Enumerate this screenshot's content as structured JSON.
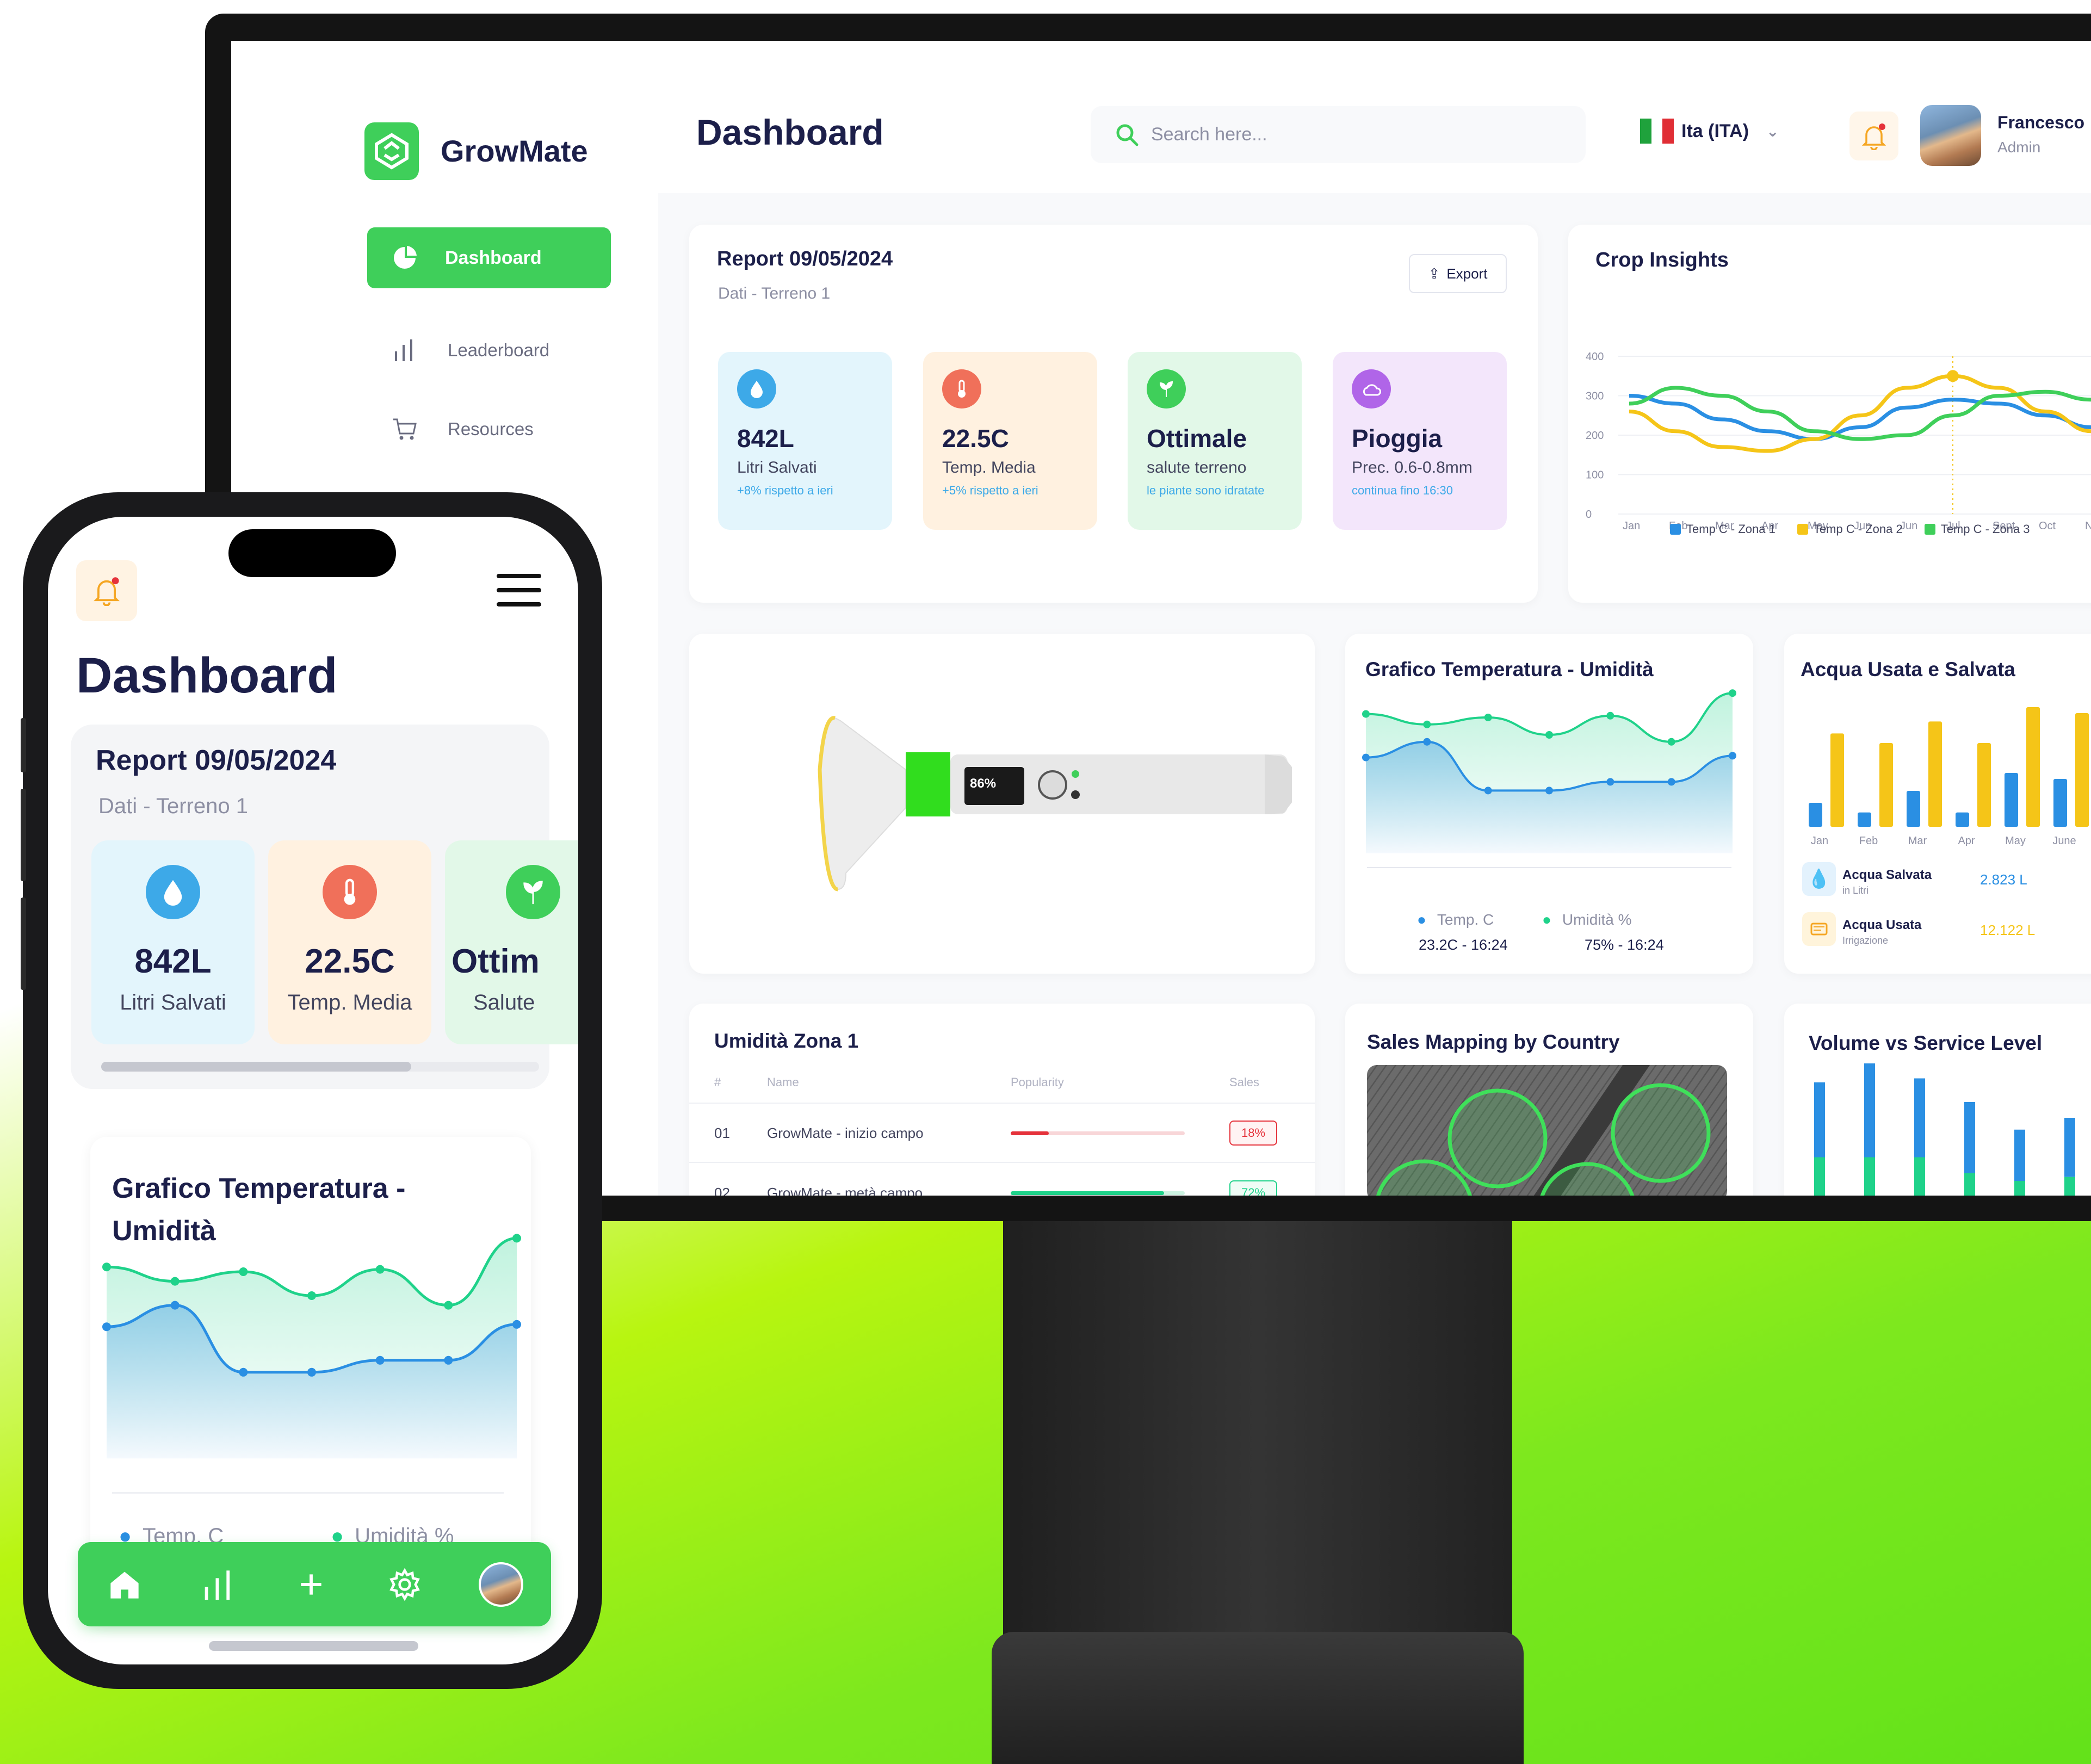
{
  "app": {
    "brand": "GrowMate",
    "page_title": "Dashboard"
  },
  "sidebar": {
    "items": [
      {
        "label": "Dashboard",
        "icon": "pie-chart-icon",
        "active": true
      },
      {
        "label": "Leaderboard",
        "icon": "bar-chart-icon"
      },
      {
        "label": "Resources",
        "icon": "cart-icon"
      }
    ]
  },
  "header": {
    "search_placeholder": "Search here...",
    "language": "Ita (ITA)",
    "user": {
      "name": "Francesco",
      "role": "Admin"
    }
  },
  "report": {
    "title": "Report 09/05/2024",
    "subtitle": "Dati - Terreno 1",
    "export_label": "Export",
    "kpis": [
      {
        "value": "842L",
        "label": "Litri Salvati",
        "note": "+8% rispetto a ieri",
        "icon": "water-drop-icon",
        "bg": "#e3f5fc",
        "accent": "#3da9e8"
      },
      {
        "value": "22.5C",
        "label": "Temp. Media",
        "note": "+5% rispetto a ieri",
        "icon": "thermometer-icon",
        "bg": "#fff1e0",
        "accent": "#f0705a"
      },
      {
        "value": "Ottimale",
        "label": "salute terreno",
        "note": "le piante sono idratate",
        "icon": "plant-icon",
        "bg": "#e2f8e8",
        "accent": "#3fcf5a"
      },
      {
        "value": "Pioggia",
        "label": "Prec. 0.6-0.8mm",
        "note": "continua fino 16:30",
        "icon": "cloud-sun-icon",
        "bg": "#f3e6fb",
        "accent": "#b065e8"
      }
    ]
  },
  "crop_insights": {
    "title": "Crop Insights"
  },
  "temp_hum": {
    "title": "Grafico Temperatura - Umidità",
    "legend": [
      {
        "label": "Temp. C",
        "value": "23.2C - 16:24",
        "color": "#2a8fe3"
      },
      {
        "label": "Umidità %",
        "value": "75% - 16:24",
        "color": "#1fd28a"
      }
    ]
  },
  "water": {
    "title": "Acqua Usata e Salvata",
    "saved": {
      "label": "Acqua Salvata",
      "sub": "in Litri",
      "value": "2.823 L"
    },
    "used": {
      "label": "Acqua Usata",
      "sub": "Irrigazione",
      "value": "12.122 L"
    }
  },
  "humidity_table": {
    "title": "Umidità Zona 1",
    "columns": [
      "#",
      "Name",
      "Popularity",
      "Sales"
    ],
    "rows": [
      {
        "num": "01",
        "name": "GrowMate - inizio campo",
        "popularity": 0.22,
        "sales": "18%",
        "color": "#e5323b"
      },
      {
        "num": "02",
        "name": "GrowMate - metà campo",
        "popularity": 0.88,
        "sales": "72%",
        "color": "#1fd28a"
      }
    ]
  },
  "sales_map": {
    "title": "Sales Mapping by Country"
  },
  "volume": {
    "title": "Volume vs Service Level"
  },
  "device": {
    "display_value": "86%"
  },
  "phone": {
    "title": "Dashboard",
    "report_title": "Report 09/05/2024",
    "report_subtitle": "Dati - Terreno 1",
    "kpis": [
      {
        "value": "842L",
        "label": "Litri Salvati"
      },
      {
        "value": "22.5C",
        "label": "Temp. Media"
      },
      {
        "value": "Ottim",
        "label": "Salute"
      }
    ],
    "chart_title_1": "Grafico Temperatura -",
    "chart_title_2": "Umidità",
    "legend_temp": "Temp. C",
    "legend_hum": "Umidità %"
  },
  "chart_data": [
    {
      "type": "line",
      "title": "Crop Insights",
      "categories": [
        "Jan",
        "Feb",
        "Mar",
        "Apr",
        "May",
        "Jun",
        "Jun",
        "Jul",
        "Sept",
        "Oct",
        "Nov"
      ],
      "ylim": [
        0,
        400
      ],
      "yticks": [
        0,
        100,
        200,
        300,
        400
      ],
      "series": [
        {
          "name": "Temp C - Zona 1",
          "color": "#2a8fe3",
          "values": [
            300,
            280,
            240,
            210,
            190,
            220,
            270,
            290,
            280,
            250,
            220
          ]
        },
        {
          "name": "Temp C - Zona 2",
          "color": "#f5c518",
          "values": [
            260,
            210,
            170,
            160,
            190,
            250,
            320,
            350,
            320,
            260,
            210
          ]
        },
        {
          "name": "Temp C - Zona 3",
          "color": "#3fcf5a",
          "values": [
            280,
            320,
            300,
            260,
            210,
            190,
            200,
            250,
            300,
            310,
            290
          ]
        }
      ],
      "legend": "bottom"
    },
    {
      "type": "area",
      "title": "Grafico Temperatura - Umidità",
      "x": [
        1,
        2,
        3,
        4,
        5,
        6,
        7
      ],
      "series": [
        {
          "name": "Umidità %",
          "color": "#1fd28a",
          "values": [
            82,
            76,
            80,
            70,
            81,
            66,
            94
          ]
        },
        {
          "name": "Temp. C",
          "color": "#2a8fe3",
          "values": [
            57,
            66,
            38,
            38,
            43,
            43,
            58
          ]
        }
      ]
    },
    {
      "type": "bar",
      "title": "Acqua Usata e Salvata",
      "categories": [
        "Jan",
        "Feb",
        "Mar",
        "Apr",
        "May",
        "June"
      ],
      "series": [
        {
          "name": "Acqua Salvata",
          "color": "#2a8fe3",
          "values": [
            20,
            12,
            30,
            12,
            45,
            40
          ]
        },
        {
          "name": "Acqua Usata",
          "color": "#f5c518",
          "values": [
            78,
            70,
            88,
            70,
            100,
            95
          ]
        }
      ]
    },
    {
      "type": "bar",
      "title": "Volume vs Service Level",
      "series": [
        {
          "name": "Volume",
          "color": "#2a8fe3",
          "values": [
            95,
            120,
            100,
            90,
            65,
            75
          ]
        },
        {
          "name": "Service Level",
          "color": "#1fd28a",
          "values": [
            50,
            50,
            50,
            30,
            20,
            25
          ]
        }
      ]
    }
  ]
}
